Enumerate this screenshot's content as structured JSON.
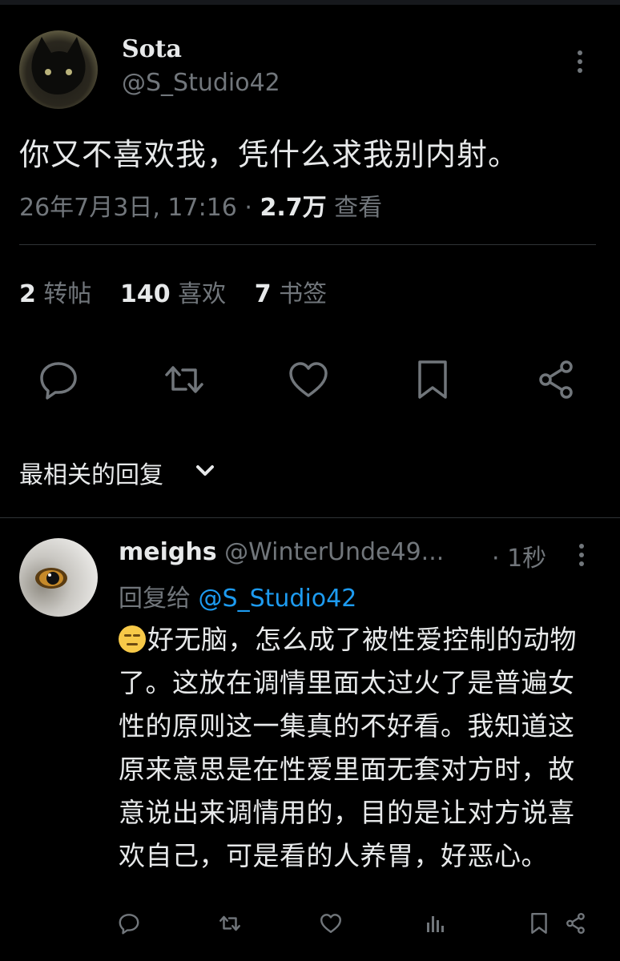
{
  "tweet": {
    "display_name": "Sota",
    "handle": "@S_Studio42",
    "text": "你又不喜欢我，凭什么求我别内射。",
    "timestamp": "26年7月3日, 17:16",
    "separator": " · ",
    "views_count": "2.7万",
    "views_label": " 查看",
    "stats": [
      {
        "num": "2",
        "label": " 转帖"
      },
      {
        "num": "140",
        "label": " 喜欢"
      },
      {
        "num": "7",
        "label": " 书签"
      }
    ],
    "actions": [
      "reply-icon",
      "retweet-icon",
      "like-icon",
      "bookmark-icon",
      "share-icon"
    ]
  },
  "replies_filter": {
    "label": "最相关的回复",
    "icon": "chevron-down-icon"
  },
  "reply": {
    "display_name": "meighs",
    "handle": "@WinterUnde49...",
    "time": "· 1秒",
    "replying_to_label": "回复给",
    "replying_to_handle": "@S_Studio42",
    "emoji": "expressionless-face-icon",
    "text": "好无脑，怎么成了被性爱控制的动物了。这放在调情里面太过火了是普遍女性的原则这一集真的不好看。我知道这原来意思是在性爱里面无套对方时，故意说出来调情用的，目的是让对方说喜欢自己，可是看的人养胃，好恶心。",
    "actions": [
      "reply-icon",
      "retweet-icon",
      "like-icon",
      "analytics-icon",
      "bookmark-icon",
      "share-icon"
    ]
  },
  "colors": {
    "background": "#000000",
    "text_primary": "#e7e9ea",
    "text_secondary": "#71767b",
    "link": "#1d9bf0",
    "divider": "#2f3336"
  }
}
